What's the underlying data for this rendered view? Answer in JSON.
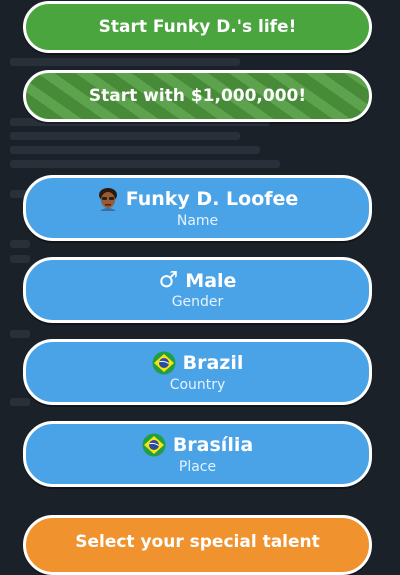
{
  "buttons": {
    "start_life": "Start Funky D.'s life!",
    "start_million": "Start with $1,000,000!",
    "name": {
      "value": "Funky D. Loofee",
      "label": "Name"
    },
    "gender": {
      "value": "Male",
      "label": "Gender",
      "icon": "male-symbol-icon"
    },
    "country": {
      "value": "Brazil",
      "label": "Country",
      "icon": "brazil-flag-icon"
    },
    "place": {
      "value": "Brasília",
      "label": "Place",
      "icon": "brazil-flag-icon"
    },
    "talent": "Select your special talent"
  },
  "colors": {
    "green": "#4aa53f",
    "blue": "#4aa3e6",
    "orange": "#f0922e",
    "background": "#1b2129"
  }
}
